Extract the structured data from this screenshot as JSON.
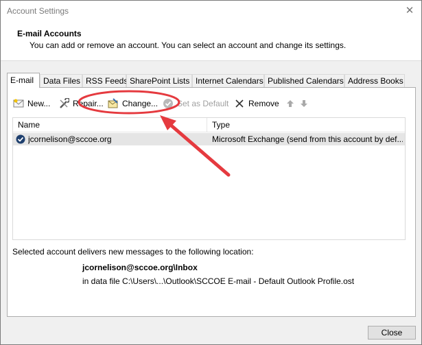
{
  "window": {
    "title": "Account Settings"
  },
  "header": {
    "title": "E-mail Accounts",
    "subtitle": "You can add or remove an account. You can select an account and change its settings."
  },
  "tabs": [
    {
      "label": "E-mail",
      "active": true
    },
    {
      "label": "Data Files"
    },
    {
      "label": "RSS Feeds"
    },
    {
      "label": "SharePoint Lists"
    },
    {
      "label": "Internet Calendars"
    },
    {
      "label": "Published Calendars"
    },
    {
      "label": "Address Books"
    }
  ],
  "toolbar": {
    "new_label": "New...",
    "repair_label": "Repair...",
    "change_label": "Change...",
    "set_default_label": "Set as Default",
    "remove_label": "Remove"
  },
  "list": {
    "columns": [
      "Name",
      "Type"
    ],
    "rows": [
      {
        "name": "jcornelison@sccoe.org",
        "type": "Microsoft Exchange (send from this account by def..."
      }
    ]
  },
  "delivery": {
    "caption": "Selected account delivers new messages to the following location:",
    "location": "jcornelison@sccoe.org\\Inbox",
    "data_file": "in data file C:\\Users\\...\\Outlook\\SCCOE E-mail - Default Outlook Profile.ost"
  },
  "footer": {
    "close_label": "Close"
  },
  "colors": {
    "annotation": "#e53a3f",
    "selected_row": "#e5e5e5",
    "default_check": "#1e3f6e"
  }
}
